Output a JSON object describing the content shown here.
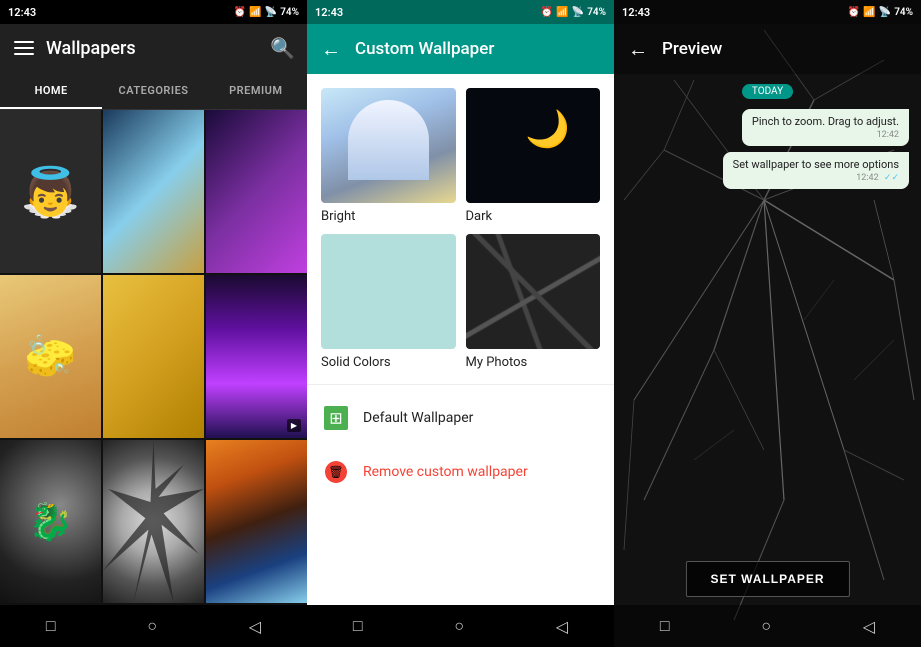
{
  "panel1": {
    "statusBar": {
      "time": "12:43",
      "icons": "📵🔊74%"
    },
    "toolbar": {
      "title": "Wallpapers",
      "menuIcon": "☰",
      "searchIcon": "🔍"
    },
    "tabs": [
      {
        "label": "HOME",
        "active": true
      },
      {
        "label": "CATEGORIES",
        "active": false
      },
      {
        "label": "PREMIUM",
        "active": false
      }
    ],
    "navButtons": [
      "□",
      "○",
      "◁"
    ]
  },
  "panel2": {
    "statusBar": {
      "time": "12:43"
    },
    "toolbar": {
      "backIcon": "←",
      "title": "Custom Wallpaper"
    },
    "options": [
      {
        "label": "Bright",
        "type": "bright"
      },
      {
        "label": "Dark",
        "type": "dark"
      },
      {
        "label": "Solid Colors",
        "type": "solid"
      },
      {
        "label": "My Photos",
        "type": "photos"
      }
    ],
    "menuItems": [
      {
        "label": "Default Wallpaper",
        "iconType": "default"
      },
      {
        "label": "Remove custom wallpaper",
        "iconType": "remove",
        "red": true
      }
    ],
    "navButtons": [
      "□",
      "○",
      "◁"
    ]
  },
  "panel3": {
    "statusBar": {
      "time": "12:43"
    },
    "toolbar": {
      "backIcon": "←",
      "title": "Preview"
    },
    "chat": {
      "dateBadge": "TODAY",
      "bubble1": {
        "text": "Pinch to zoom. Drag to adjust.",
        "time": "12:42"
      },
      "bubble2": {
        "text": "Set wallpaper to see more options",
        "time": "12:42",
        "checkmark": "✓✓"
      }
    },
    "setWallpaperButton": "SET WALLPAPER",
    "navButtons": [
      "□",
      "○",
      "◁"
    ]
  }
}
